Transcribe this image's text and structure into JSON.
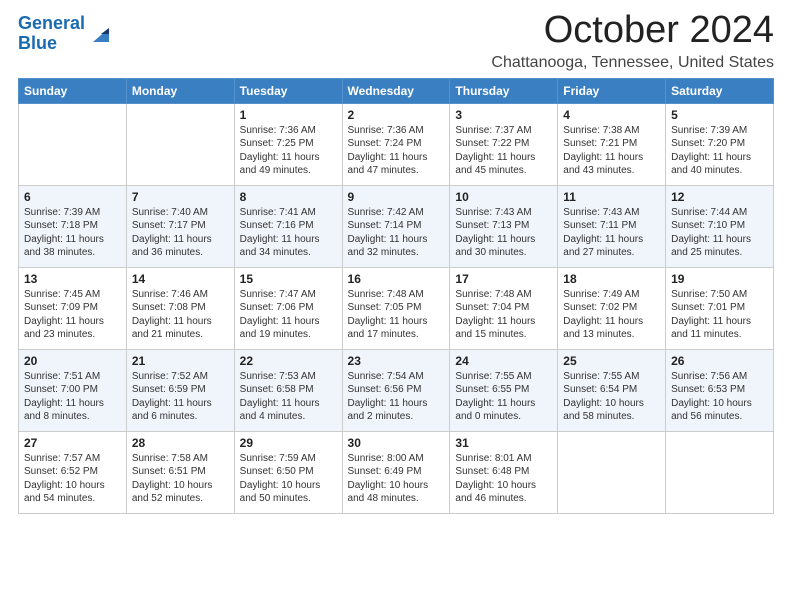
{
  "header": {
    "logo_line1": "General",
    "logo_line2": "Blue",
    "month": "October 2024",
    "location": "Chattanooga, Tennessee, United States"
  },
  "days_of_week": [
    "Sunday",
    "Monday",
    "Tuesday",
    "Wednesday",
    "Thursday",
    "Friday",
    "Saturday"
  ],
  "weeks": [
    [
      {
        "day": "",
        "info": ""
      },
      {
        "day": "",
        "info": ""
      },
      {
        "day": "1",
        "info": "Sunrise: 7:36 AM\nSunset: 7:25 PM\nDaylight: 11 hours and 49 minutes."
      },
      {
        "day": "2",
        "info": "Sunrise: 7:36 AM\nSunset: 7:24 PM\nDaylight: 11 hours and 47 minutes."
      },
      {
        "day": "3",
        "info": "Sunrise: 7:37 AM\nSunset: 7:22 PM\nDaylight: 11 hours and 45 minutes."
      },
      {
        "day": "4",
        "info": "Sunrise: 7:38 AM\nSunset: 7:21 PM\nDaylight: 11 hours and 43 minutes."
      },
      {
        "day": "5",
        "info": "Sunrise: 7:39 AM\nSunset: 7:20 PM\nDaylight: 11 hours and 40 minutes."
      }
    ],
    [
      {
        "day": "6",
        "info": "Sunrise: 7:39 AM\nSunset: 7:18 PM\nDaylight: 11 hours and 38 minutes."
      },
      {
        "day": "7",
        "info": "Sunrise: 7:40 AM\nSunset: 7:17 PM\nDaylight: 11 hours and 36 minutes."
      },
      {
        "day": "8",
        "info": "Sunrise: 7:41 AM\nSunset: 7:16 PM\nDaylight: 11 hours and 34 minutes."
      },
      {
        "day": "9",
        "info": "Sunrise: 7:42 AM\nSunset: 7:14 PM\nDaylight: 11 hours and 32 minutes."
      },
      {
        "day": "10",
        "info": "Sunrise: 7:43 AM\nSunset: 7:13 PM\nDaylight: 11 hours and 30 minutes."
      },
      {
        "day": "11",
        "info": "Sunrise: 7:43 AM\nSunset: 7:11 PM\nDaylight: 11 hours and 27 minutes."
      },
      {
        "day": "12",
        "info": "Sunrise: 7:44 AM\nSunset: 7:10 PM\nDaylight: 11 hours and 25 minutes."
      }
    ],
    [
      {
        "day": "13",
        "info": "Sunrise: 7:45 AM\nSunset: 7:09 PM\nDaylight: 11 hours and 23 minutes."
      },
      {
        "day": "14",
        "info": "Sunrise: 7:46 AM\nSunset: 7:08 PM\nDaylight: 11 hours and 21 minutes."
      },
      {
        "day": "15",
        "info": "Sunrise: 7:47 AM\nSunset: 7:06 PM\nDaylight: 11 hours and 19 minutes."
      },
      {
        "day": "16",
        "info": "Sunrise: 7:48 AM\nSunset: 7:05 PM\nDaylight: 11 hours and 17 minutes."
      },
      {
        "day": "17",
        "info": "Sunrise: 7:48 AM\nSunset: 7:04 PM\nDaylight: 11 hours and 15 minutes."
      },
      {
        "day": "18",
        "info": "Sunrise: 7:49 AM\nSunset: 7:02 PM\nDaylight: 11 hours and 13 minutes."
      },
      {
        "day": "19",
        "info": "Sunrise: 7:50 AM\nSunset: 7:01 PM\nDaylight: 11 hours and 11 minutes."
      }
    ],
    [
      {
        "day": "20",
        "info": "Sunrise: 7:51 AM\nSunset: 7:00 PM\nDaylight: 11 hours and 8 minutes."
      },
      {
        "day": "21",
        "info": "Sunrise: 7:52 AM\nSunset: 6:59 PM\nDaylight: 11 hours and 6 minutes."
      },
      {
        "day": "22",
        "info": "Sunrise: 7:53 AM\nSunset: 6:58 PM\nDaylight: 11 hours and 4 minutes."
      },
      {
        "day": "23",
        "info": "Sunrise: 7:54 AM\nSunset: 6:56 PM\nDaylight: 11 hours and 2 minutes."
      },
      {
        "day": "24",
        "info": "Sunrise: 7:55 AM\nSunset: 6:55 PM\nDaylight: 11 hours and 0 minutes."
      },
      {
        "day": "25",
        "info": "Sunrise: 7:55 AM\nSunset: 6:54 PM\nDaylight: 10 hours and 58 minutes."
      },
      {
        "day": "26",
        "info": "Sunrise: 7:56 AM\nSunset: 6:53 PM\nDaylight: 10 hours and 56 minutes."
      }
    ],
    [
      {
        "day": "27",
        "info": "Sunrise: 7:57 AM\nSunset: 6:52 PM\nDaylight: 10 hours and 54 minutes."
      },
      {
        "day": "28",
        "info": "Sunrise: 7:58 AM\nSunset: 6:51 PM\nDaylight: 10 hours and 52 minutes."
      },
      {
        "day": "29",
        "info": "Sunrise: 7:59 AM\nSunset: 6:50 PM\nDaylight: 10 hours and 50 minutes."
      },
      {
        "day": "30",
        "info": "Sunrise: 8:00 AM\nSunset: 6:49 PM\nDaylight: 10 hours and 48 minutes."
      },
      {
        "day": "31",
        "info": "Sunrise: 8:01 AM\nSunset: 6:48 PM\nDaylight: 10 hours and 46 minutes."
      },
      {
        "day": "",
        "info": ""
      },
      {
        "day": "",
        "info": ""
      }
    ]
  ]
}
